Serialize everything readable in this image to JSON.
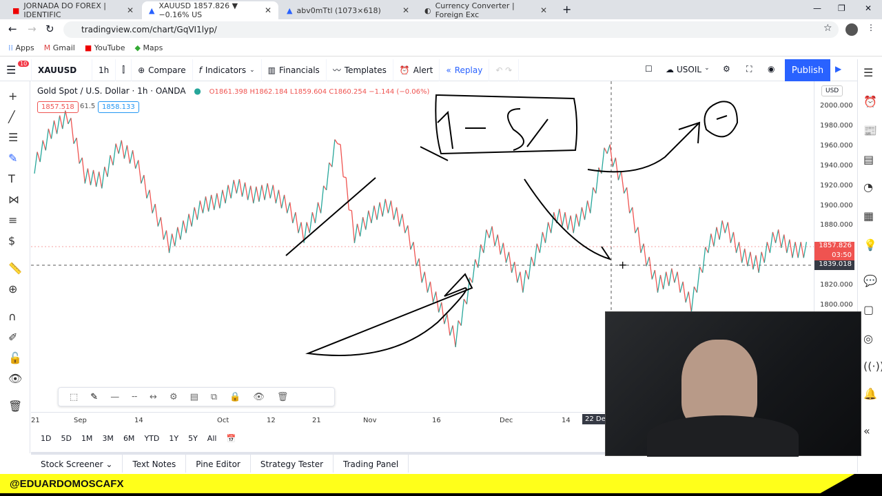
{
  "browser": {
    "tabs": [
      {
        "title": "JORNADA DO FOREX | IDENTIFIC"
      },
      {
        "title": "XAUUSD 1857.826 ▼ −0.16% US"
      },
      {
        "title": "abv0mTtl (1073×618)"
      },
      {
        "title": "Currency Converter | Foreign Exc"
      }
    ],
    "url": "tradingview.com/chart/GqVI1lyp/",
    "bookmarks": [
      "Apps",
      "Gmail",
      "YouTube",
      "Maps"
    ]
  },
  "toolbar": {
    "notif_count": "10",
    "symbol": "XAUUSD",
    "interval": "1h",
    "compare": "Compare",
    "indicators": "Indicators",
    "financials": "Financials",
    "templates": "Templates",
    "alert": "Alert",
    "replay": "Replay",
    "watchlist": "USOIL",
    "publish": "Publish"
  },
  "legend": {
    "title": "Gold Spot / U.S. Dollar · 1h · OANDA",
    "o": "O1861.398",
    "h": "H1862.184",
    "l": "L1859.604",
    "c": "C1860.254",
    "change": "−1.144 (−0.06%)",
    "bid": "1857.518",
    "spread": "61.5",
    "ask": "1858.133"
  },
  "price_axis": {
    "currency": "USD",
    "labels": [
      "2000.000",
      "1980.000",
      "1960.000",
      "1940.000",
      "1920.000",
      "1900.000",
      "1880.000",
      "1820.000",
      "1800.000"
    ],
    "last_price": "1857.826",
    "countdown": "03:50",
    "crosshair_price": "1839.018"
  },
  "time_axis": {
    "labels": [
      "21",
      "Sep",
      "14",
      "Oct",
      "12",
      "21",
      "Nov",
      "16",
      "Dec",
      "14"
    ],
    "crosshair_date": "22 Dec"
  },
  "ranges": [
    "1D",
    "5D",
    "1M",
    "3M",
    "6M",
    "YTD",
    "1Y",
    "5Y",
    "All"
  ],
  "bottom_tabs": [
    "Stock Screener",
    "Text Notes",
    "Pine Editor",
    "Strategy Tester",
    "Trading Panel"
  ],
  "banner": "@EDUARDOMOSCAFX",
  "colors": {
    "accent": "#2962ff",
    "up": "#26a69a",
    "down": "#ef5350",
    "banner": "#ffff1a"
  },
  "chart_data": {
    "type": "line",
    "ylim": [
      1760,
      2010
    ],
    "values": [
      1940,
      1975,
      1990,
      1930,
      1925,
      1960,
      1945,
      1900,
      1860,
      1880,
      1900,
      1905,
      1920,
      1910,
      1915,
      1900,
      1870,
      1900,
      1970,
      1870,
      1890,
      1900,
      1880,
      1830,
      1800,
      1765,
      1830,
      1875,
      1850,
      1820,
      1860,
      1890,
      1880,
      1900,
      1960,
      1920,
      1860,
      1820,
      1830,
      1800,
      1860,
      1880,
      1850,
      1840,
      1870,
      1855
    ]
  }
}
